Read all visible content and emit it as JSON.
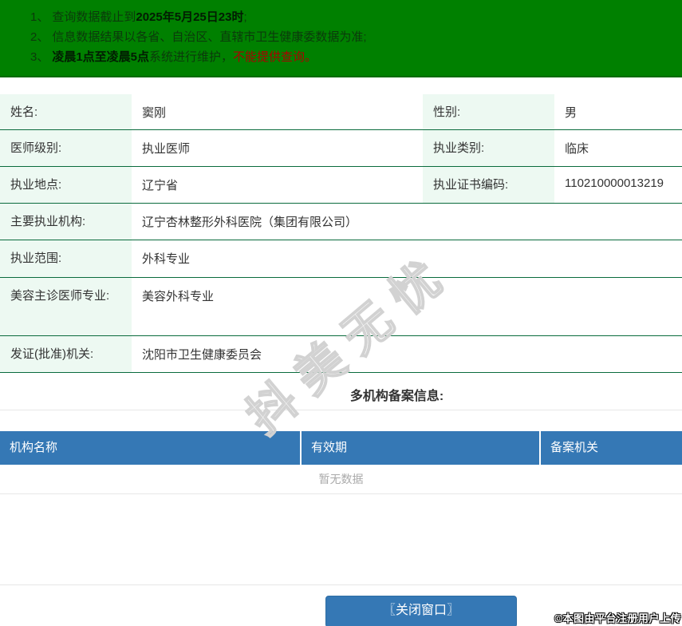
{
  "colors": {
    "banner_green": "#008000",
    "notice_text_dark_green": "#0b3a0b",
    "notice_red": "#ad0000",
    "row_border_green": "#0a6b3d",
    "label_cell_mint": "#edf9f2",
    "header_blue": "#3578b5",
    "empty_text_gray": "#aaaaaa"
  },
  "banner": {
    "line1": {
      "num": "1、",
      "pre": "查询数据截止到",
      "bold": "2025年5月25日23时",
      "tail": ";"
    },
    "line2": {
      "num": "2、",
      "text": "信息数据结果以各省、自治区、直辖市卫生健康委数据为准;"
    },
    "line3": {
      "num": "3、",
      "bold": "凌晨1点至凌晨5点",
      "mid": "系统进行维护，",
      "red": "不能提供查询。"
    }
  },
  "profile": {
    "rows": [
      {
        "label1": "姓名:",
        "value1": "窦刚",
        "label2": "性别:",
        "value2": "男"
      },
      {
        "label1": "医师级别:",
        "value1": "执业医师",
        "label2": "执业类别:",
        "value2": "临床"
      },
      {
        "label1": "执业地点:",
        "value1": "辽宁省",
        "label2": "执业证书编码:",
        "value2": "110210000013219"
      },
      {
        "label1": "主要执业机构:",
        "value1": "辽宁杏林整形外科医院（集团有限公司）"
      },
      {
        "label1": "执业范围:",
        "value1": "外科专业"
      },
      {
        "label1": "美容主诊医师专业:",
        "value1": "美容外科专业"
      },
      {
        "label1": "发证(批准)机关:",
        "value1": "沈阳市卫生健康委员会"
      }
    ]
  },
  "backup_section": {
    "title": "多机构备案信息:",
    "columns": [
      "机构名称",
      "有效期",
      "备案机关"
    ],
    "empty_text": "暂无数据"
  },
  "watermark": {
    "text": "抖美无忧"
  },
  "footer": {
    "close_button": "〖关闭窗口〗",
    "copyright": "©本图由平台注册用户上传"
  }
}
